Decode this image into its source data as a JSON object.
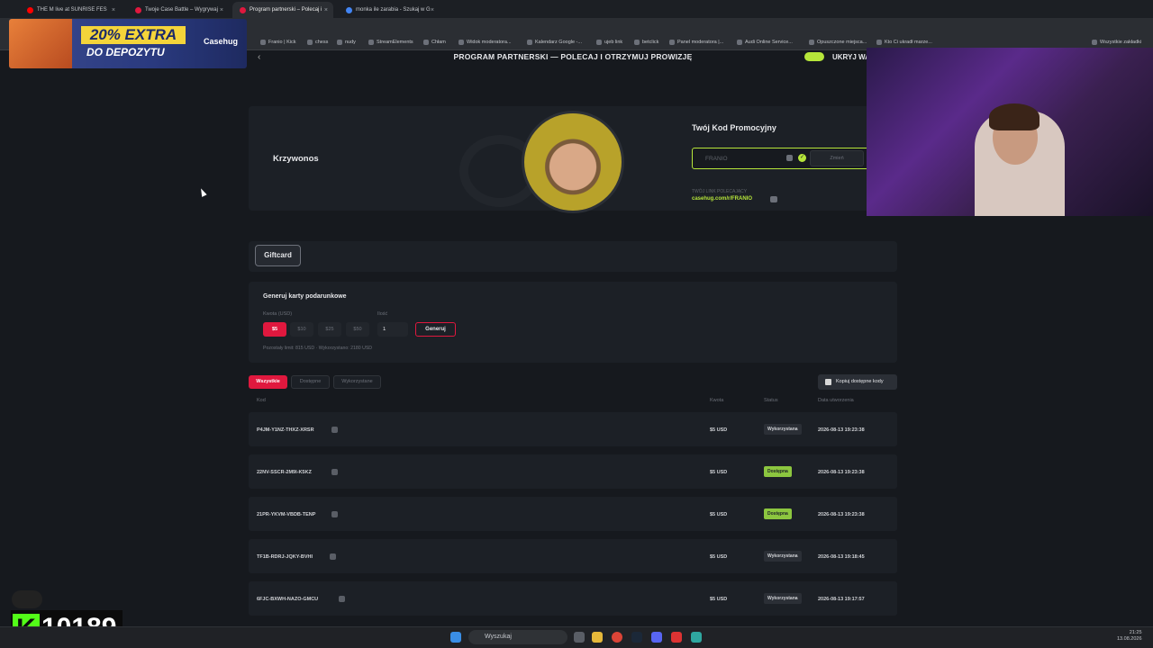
{
  "browser": {
    "tabs": [
      {
        "label": "THE M live at SUNRISE FES",
        "fav": "#ff0000"
      },
      {
        "label": "Twoje Case Battle – Wygrywaj",
        "fav": "#e0183e"
      },
      {
        "label": "Program partnerski – Polecaj i",
        "fav": "#e0183e"
      },
      {
        "label": "monka ile zarabia - Szukaj w G",
        "fav": "#4285f4"
      }
    ],
    "bookmarks": [
      "Franio | Kick",
      "chess",
      "nudy",
      "StreamElements",
      "Chłam",
      "Widok moderatora...",
      "Kalendarz Google -...",
      "ujeb link",
      "betclick",
      "Panel moderatora |...",
      "Audi Online Service...",
      "Opuszczone miejsca...",
      "Kto Ci ukradł marze...",
      "Wszystkie zakładki"
    ]
  },
  "promo": {
    "headline": "20% EXTRA",
    "sub": "DO DEPOZYTU",
    "brand": "Casehug"
  },
  "page": {
    "title": "PROGRAM PARTNERSKI — POLECAJ I OTRZYMUJ PROWIZJĘ",
    "hide_label": "UKRYJ WA",
    "profile_name": "Krzywonos",
    "promo_code_label": "Twój Kod Promocyjny",
    "promo_code_value": "FRANIO",
    "change_label": "Zmień",
    "link_label": "TWÓJ LINK POLECAJĄCY",
    "link_value": "casehug.com/r/FRANIO",
    "giftcard_tab": "Giftcard"
  },
  "generator": {
    "title": "Generuj karty podarunkowe",
    "amount_label": "Kwota (USD)",
    "qty_label": "Ilość",
    "amounts": [
      "$5",
      "$10",
      "$25",
      "$50"
    ],
    "qty_value": "1",
    "generate_label": "Generuj",
    "limit_text": "Pozostały limit: 815 USD · Wykorzystano: 2180 USD"
  },
  "filters": {
    "all": "Wszystkie",
    "available": "Dostępne",
    "used": "Wykorzystane",
    "copy_available": "Kopiuj dostępne kody"
  },
  "table": {
    "headers": {
      "code": "Kod",
      "amount": "Kwota",
      "status": "Status",
      "date": "Data utworzenia"
    },
    "rows": [
      {
        "code": "P4JM-Y1NZ-THXZ-XRSR",
        "amount": "$5 USD",
        "status": "Wykorzystana",
        "state": "used",
        "date": "2026-08-13 19:23:38"
      },
      {
        "code": "22NV-SSCR-2M9I-K5KZ",
        "amount": "$5 USD",
        "status": "Dostępna",
        "state": "avail",
        "date": "2026-08-13 19:23:38"
      },
      {
        "code": "21PR-YKVM-VBDB-TENP",
        "amount": "$5 USD",
        "status": "Dostępna",
        "state": "avail",
        "date": "2026-08-13 19:23:38"
      },
      {
        "code": "TF1B-RDRJ-JQKY-BVHI",
        "amount": "$5 USD",
        "status": "Wykorzystana",
        "state": "used",
        "date": "2026-08-13 19:18:45"
      },
      {
        "code": "6FJC-BXWH-NAZO-GMCU",
        "amount": "$5 USD",
        "status": "Wykorzystana",
        "state": "used",
        "date": "2026-08-13 19:17:57"
      }
    ]
  },
  "kick": {
    "count": "10189",
    "logo": "K"
  },
  "taskbar": {
    "search": "Wyszukaj",
    "time": "21:25",
    "date": "13.08.2026"
  }
}
